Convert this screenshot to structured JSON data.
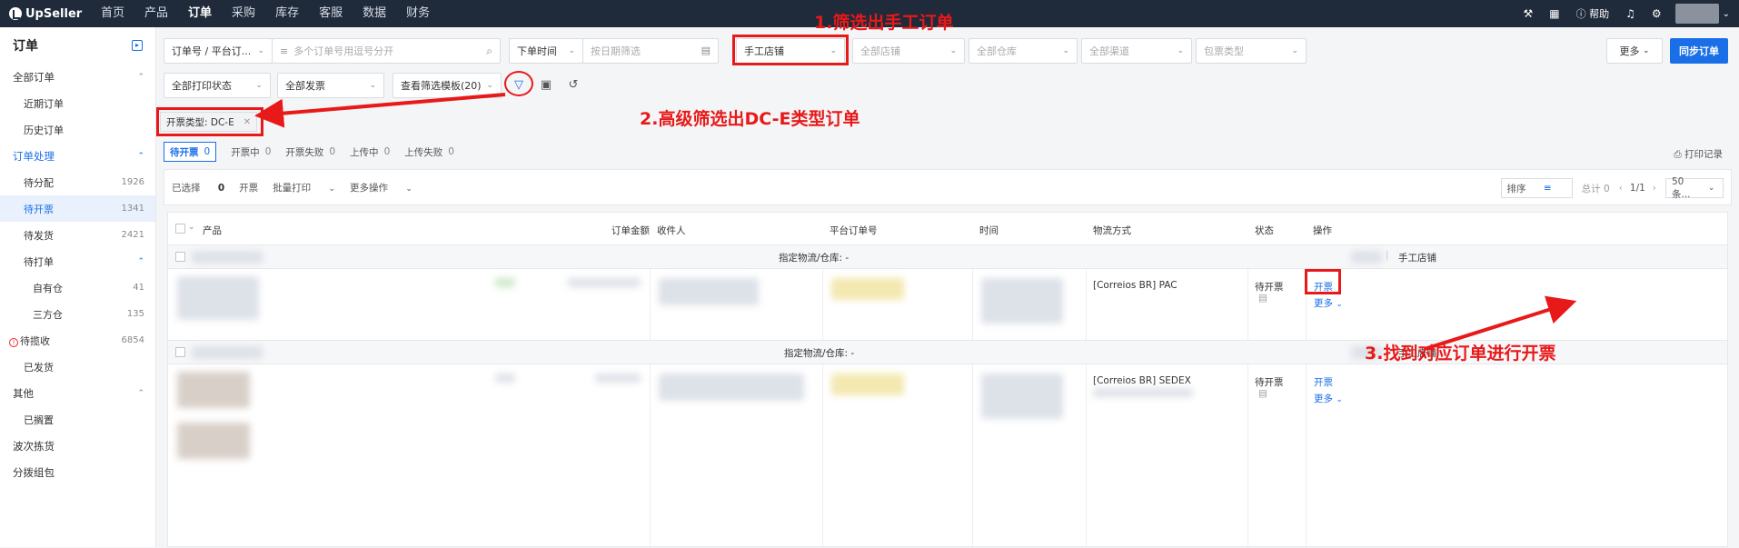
{
  "topbar": {
    "logo": "UpSeller",
    "nav": [
      "首页",
      "产品",
      "订单",
      "采购",
      "库存",
      "客服",
      "数据",
      "财务"
    ],
    "active_nav": "订单",
    "help": "帮助"
  },
  "sidebar": {
    "title": "订单",
    "items": [
      {
        "label": "全部订单",
        "level": "sec",
        "chevron": "^"
      },
      {
        "label": "近期订单",
        "level": "sub"
      },
      {
        "label": "历史订单",
        "level": "sub"
      },
      {
        "label": "订单处理",
        "level": "sec",
        "chevron": "^",
        "blue": true
      },
      {
        "label": "待分配",
        "level": "sub",
        "count": "1926"
      },
      {
        "label": "待开票",
        "level": "sub",
        "count": "1341",
        "selected": true
      },
      {
        "label": "待发货",
        "level": "sub",
        "count": "2421"
      },
      {
        "label": "待打单",
        "level": "sub",
        "chevron": "^"
      },
      {
        "label": "自有仓",
        "level": "sub2",
        "count": "41"
      },
      {
        "label": "三方仓",
        "level": "sub2",
        "count": "135"
      },
      {
        "label": "待揽收",
        "level": "sub",
        "count": "6854",
        "warn": true
      },
      {
        "label": "已发货",
        "level": "sub"
      },
      {
        "label": "其他",
        "level": "sec",
        "chevron": "^"
      },
      {
        "label": "已搁置",
        "level": "sub"
      },
      {
        "label": "波次拣货",
        "level": "sec"
      },
      {
        "label": "分拨组包",
        "level": "sec"
      }
    ]
  },
  "filters": {
    "order_no_type": "订单号 / 平台订...",
    "order_no_placeholder": "多个订单号用逗号分开",
    "time_type": "下单时间",
    "date_placeholder": "按日期筛选",
    "store": "手工店铺",
    "all_stores": "全部店铺",
    "all_warehouses": "全部仓库",
    "all_channels": "全部渠道",
    "package_type": "包票类型",
    "print_status": "全部打印状态",
    "invoice": "全部发票",
    "template": "查看筛选模板(20)",
    "more": "更多",
    "sync": "同步订单"
  },
  "active_tag": "开票类型: DC-E",
  "annotations": {
    "a1": "1.筛选出手工订单",
    "a2": "2.高级筛选出DC-E类型订单",
    "a3": "3.找到对应订单进行开票"
  },
  "tabs": [
    {
      "label": "待开票",
      "count": "0",
      "active": true
    },
    {
      "label": "开票中",
      "count": "0"
    },
    {
      "label": "开票失败",
      "count": "0"
    },
    {
      "label": "上传中",
      "count": "0"
    },
    {
      "label": "上传失败",
      "count": "0"
    }
  ],
  "print_record": "打印记录",
  "actionbar": {
    "selected_label": "已选择",
    "selected_count": "0",
    "invoice": "开票",
    "batch_print": "批量打印",
    "more_ops": "更多操作",
    "sort": "排序",
    "total": "总计 0",
    "page": "1/1",
    "page_size": "50条..."
  },
  "table": {
    "headers": {
      "product": "产品",
      "amount": "订单金额",
      "receiver": "收件人",
      "platform_no": "平台订单号",
      "time": "时间",
      "logistics": "物流方式",
      "status": "状态",
      "ops": "操作"
    },
    "groups": [
      {
        "assign": "指定物流/仓库: -",
        "store": "手工店铺",
        "logistics": "[Correios BR] PAC",
        "status": "待开票",
        "op_invoice": "开票",
        "op_more": "更多"
      },
      {
        "assign": "指定物流/仓库: -",
        "store": "手工店铺",
        "logistics": "[Correios BR] SEDEX",
        "status": "待开票",
        "op_invoice": "开票",
        "op_more": "更多"
      }
    ]
  },
  "colors": {
    "accent": "#1a6fe8",
    "annotation": "#e81919",
    "topbar": "#1f2a3a"
  }
}
